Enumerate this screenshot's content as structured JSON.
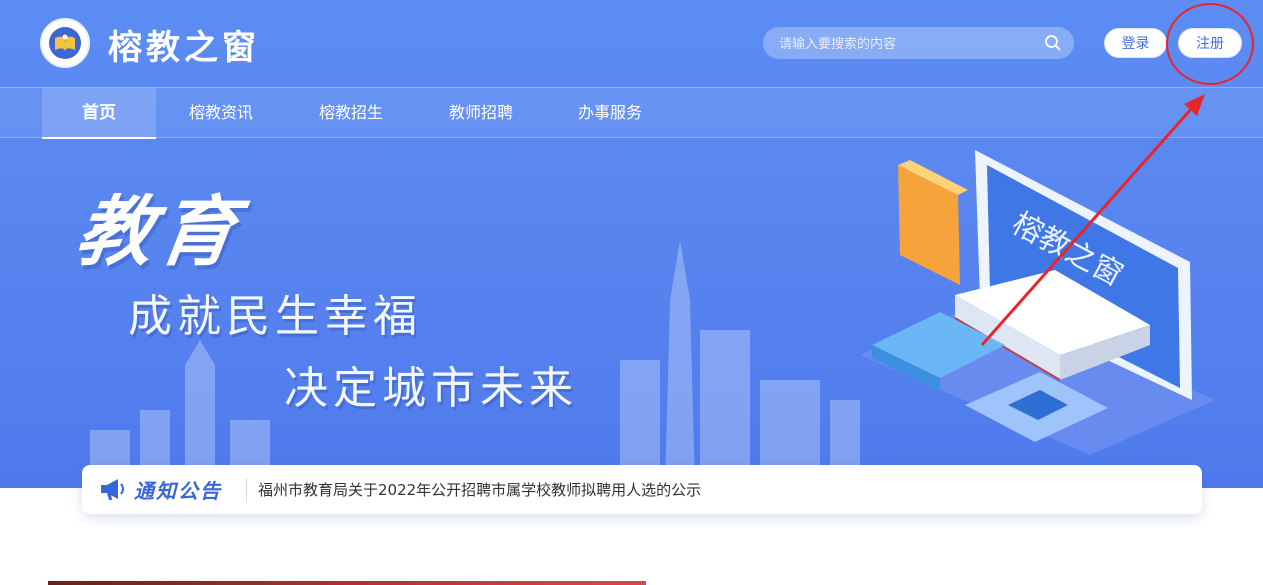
{
  "header": {
    "site_name": "榕教之窗",
    "search_placeholder": "请输入要搜索的内容",
    "login_label": "登录",
    "register_label": "注册"
  },
  "nav": {
    "items": [
      "首页",
      "榕教资讯",
      "榕教招生",
      "教师招聘",
      "办事服务"
    ],
    "active_index": 0
  },
  "banner": {
    "headline": "教育",
    "line1": "成就民生幸福",
    "line2": "决定城市未来",
    "screen_text": "榕教之窗"
  },
  "notice": {
    "title": "通知公告",
    "text": "福州市教育局关于2022年公开招聘市属学校教师拟聘用人选的公示"
  },
  "colors": {
    "brand_blue": "#5b8df3",
    "accent_blue": "#3a66dc",
    "annotation_red": "#e8262a"
  }
}
